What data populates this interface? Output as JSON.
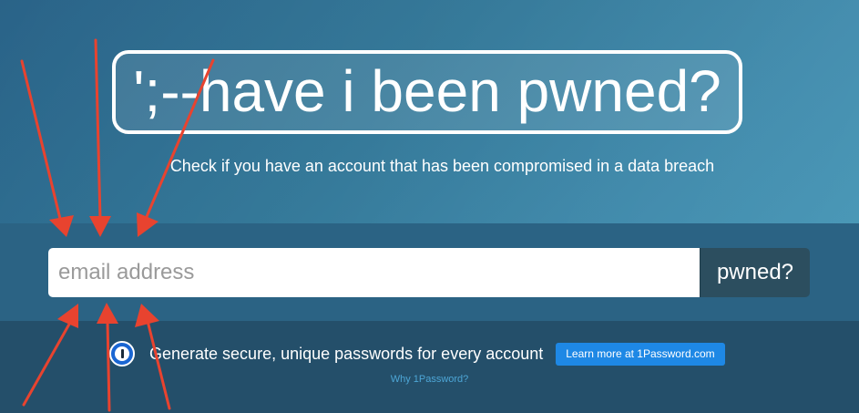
{
  "header": {
    "logo_text": "';--have i been pwned?",
    "tagline": "Check if you have an account that has been compromised in a data breach"
  },
  "search": {
    "placeholder": "email address",
    "value": "",
    "button_label": "pwned?"
  },
  "promo": {
    "icon": "1password-icon",
    "text": "Generate secure, unique passwords for every account",
    "button_label": "Learn more at 1Password.com",
    "link_text": "Why 1Password?"
  },
  "annotations": {
    "arrow_color": "#e8432f",
    "arrow_count": 6
  },
  "colors": {
    "background": "#2f7596",
    "search_band": "#2b6384",
    "promo_band": "#244f6a",
    "pwned_button": "#2c4e5f",
    "learn_more_button": "#1e88e5",
    "link": "#4da6d6"
  }
}
